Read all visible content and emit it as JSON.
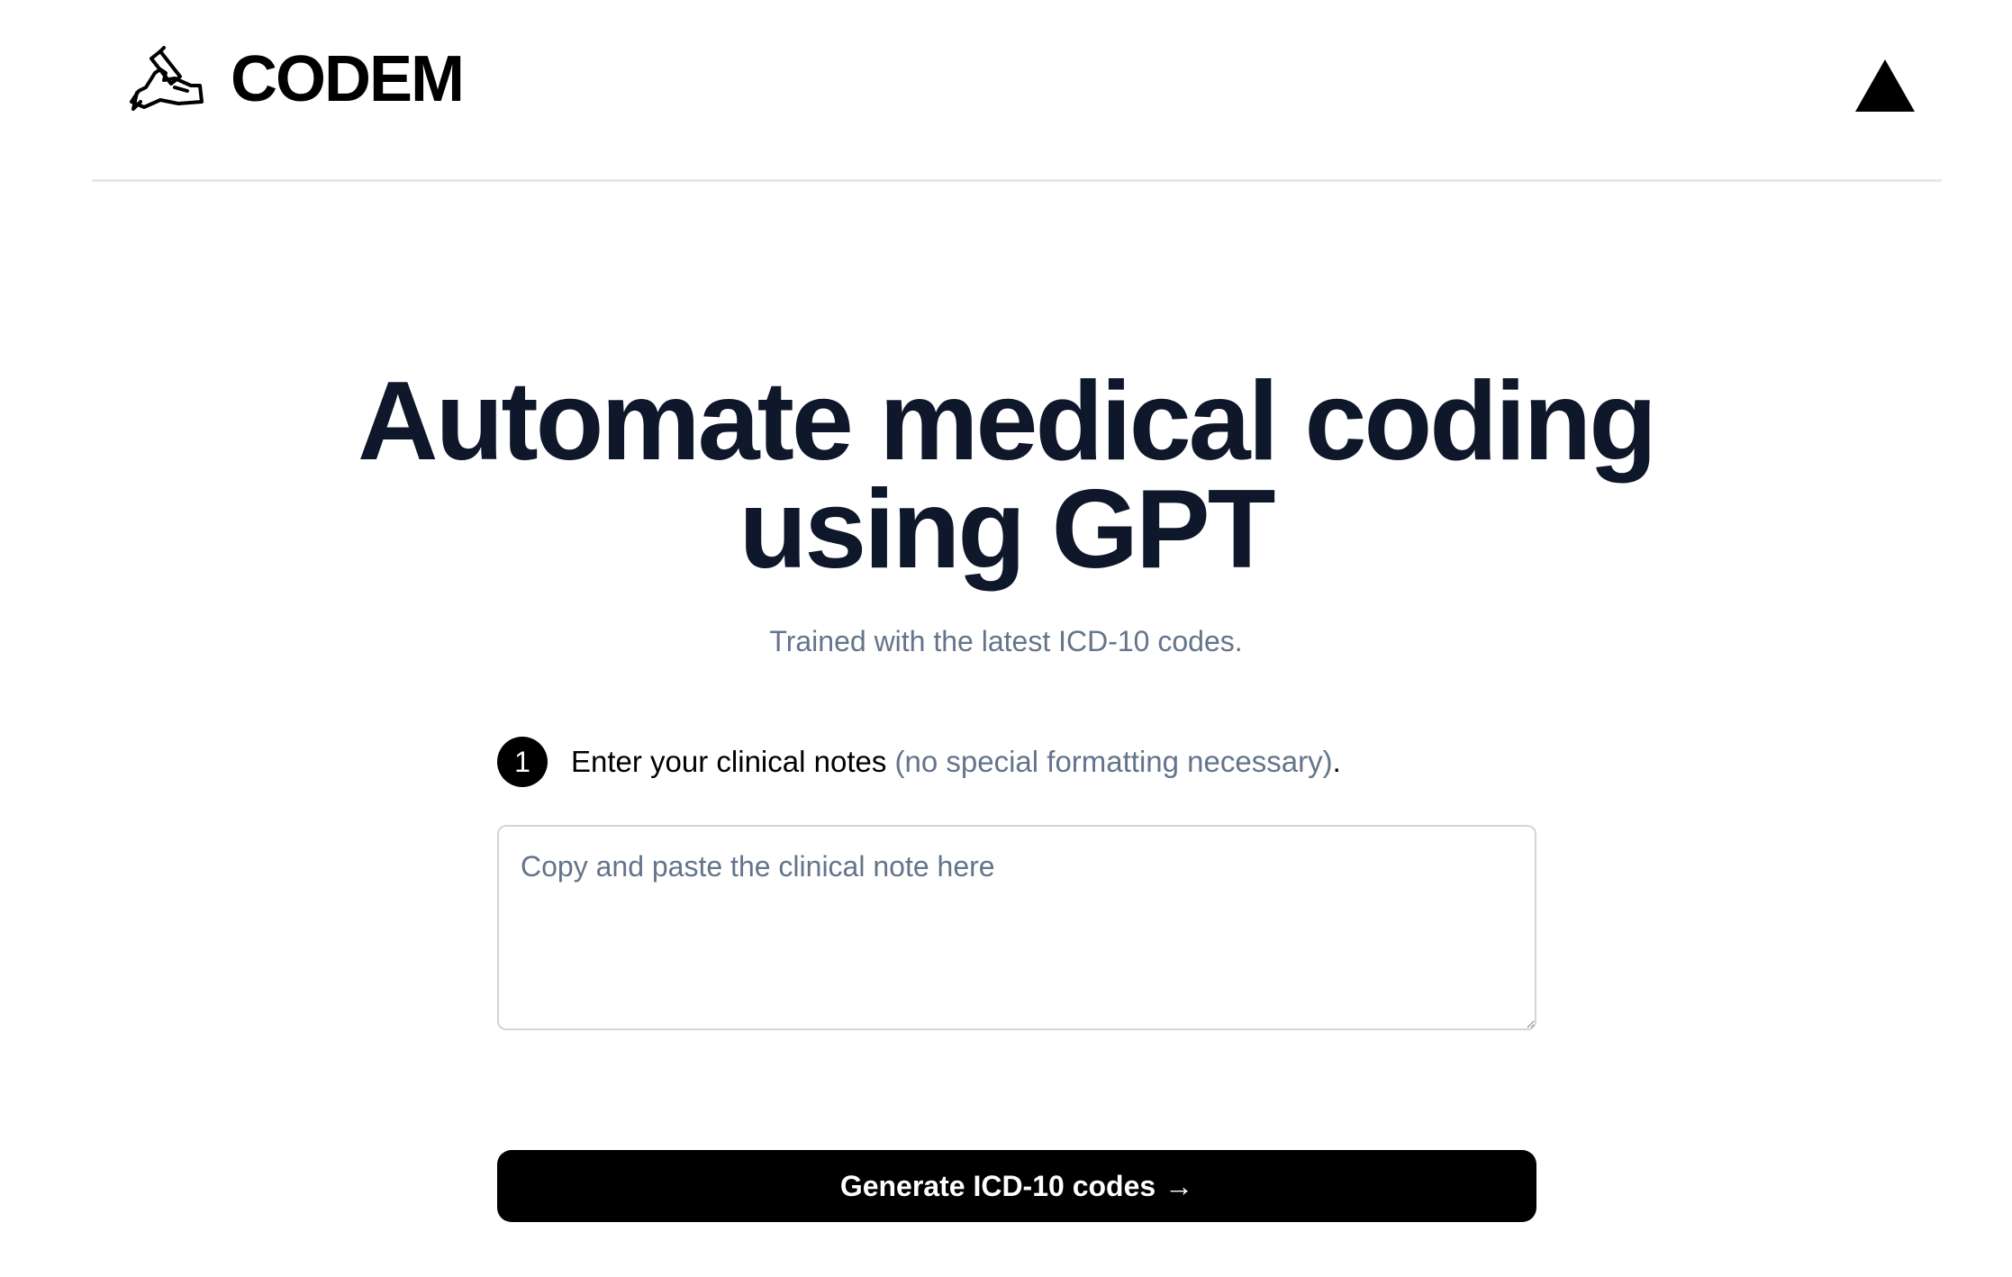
{
  "header": {
    "brand_name": "CODEM",
    "brand_icon": "hand-writing-icon",
    "right_icon": "vercel-triangle-icon"
  },
  "hero": {
    "title_line1": "Automate medical coding",
    "title_line2": "using GPT",
    "subtitle": "Trained with the latest ICD-10 codes."
  },
  "step1": {
    "number": "1",
    "label": "Enter your clinical notes",
    "hint": "(no special formatting necessary)",
    "suffix": "."
  },
  "notes": {
    "value": "",
    "placeholder": "Copy and paste the clinical note here"
  },
  "actions": {
    "generate_label": "Generate ICD-10 codes",
    "generate_arrow": "→"
  },
  "colors": {
    "heading": "#0f172a",
    "muted": "#64748b",
    "button_bg": "#000000",
    "divider": "#e5e7eb"
  }
}
